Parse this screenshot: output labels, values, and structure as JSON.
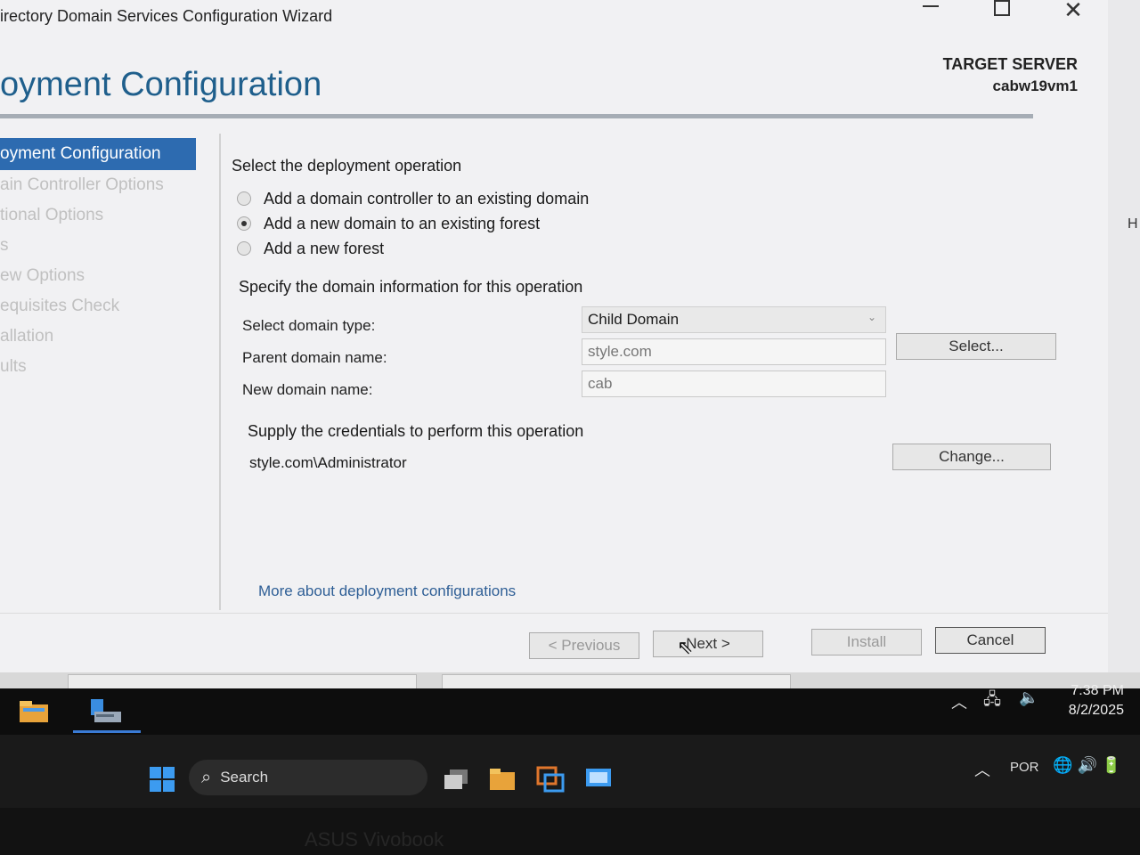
{
  "window": {
    "title": "irectory Domain Services Configuration Wizard",
    "page_title": "oyment Configuration",
    "target_server_label": "TARGET SERVER",
    "target_server_name": "cabw19vm1",
    "side_letter": "H"
  },
  "nav": {
    "items": [
      {
        "label": "oyment Configuration",
        "active": true
      },
      {
        "label": "ain Controller Options",
        "active": false
      },
      {
        "label": "tional Options",
        "active": false
      },
      {
        "label": "s",
        "active": false
      },
      {
        "label": "ew Options",
        "active": false
      },
      {
        "label": "equisites Check",
        "active": false
      },
      {
        "label": "allation",
        "active": false
      },
      {
        "label": "ults",
        "active": false
      }
    ]
  },
  "main": {
    "operation_heading": "Select the deployment operation",
    "operations": [
      {
        "label": "Add a domain controller to an existing domain",
        "checked": false
      },
      {
        "label": "Add a new domain to an existing forest",
        "checked": true
      },
      {
        "label": "Add a new forest",
        "checked": false
      }
    ],
    "domain_info_heading": "Specify the domain information for this operation",
    "domain_type_label": "Select domain type:",
    "domain_type_value": "Child Domain",
    "parent_label": "Parent domain name:",
    "parent_value": "style.com",
    "select_button": "Select...",
    "new_domain_label": "New domain name:",
    "new_domain_value": "cab",
    "credentials_heading": "Supply the credentials to perform this operation",
    "credential_user": "style.com\\Administrator",
    "change_button": "Change...",
    "more_link": "More about deployment configurations"
  },
  "footer": {
    "previous": "< Previous",
    "next": "Next >",
    "install": "Install",
    "cancel": "Cancel"
  },
  "inner_taskbar": {
    "time": "7:38 PM",
    "date": "8/2/2025",
    "icons": [
      "file-explorer-icon",
      "server-manager-icon"
    ]
  },
  "host_taskbar": {
    "search_label": "Search",
    "language": "POR",
    "icons": [
      "windows-start-icon",
      "task-view-icon",
      "file-explorer-icon",
      "remote-desktop-icon",
      "vm-connection-icon"
    ]
  },
  "device_brand": "ASUS Vivobook"
}
